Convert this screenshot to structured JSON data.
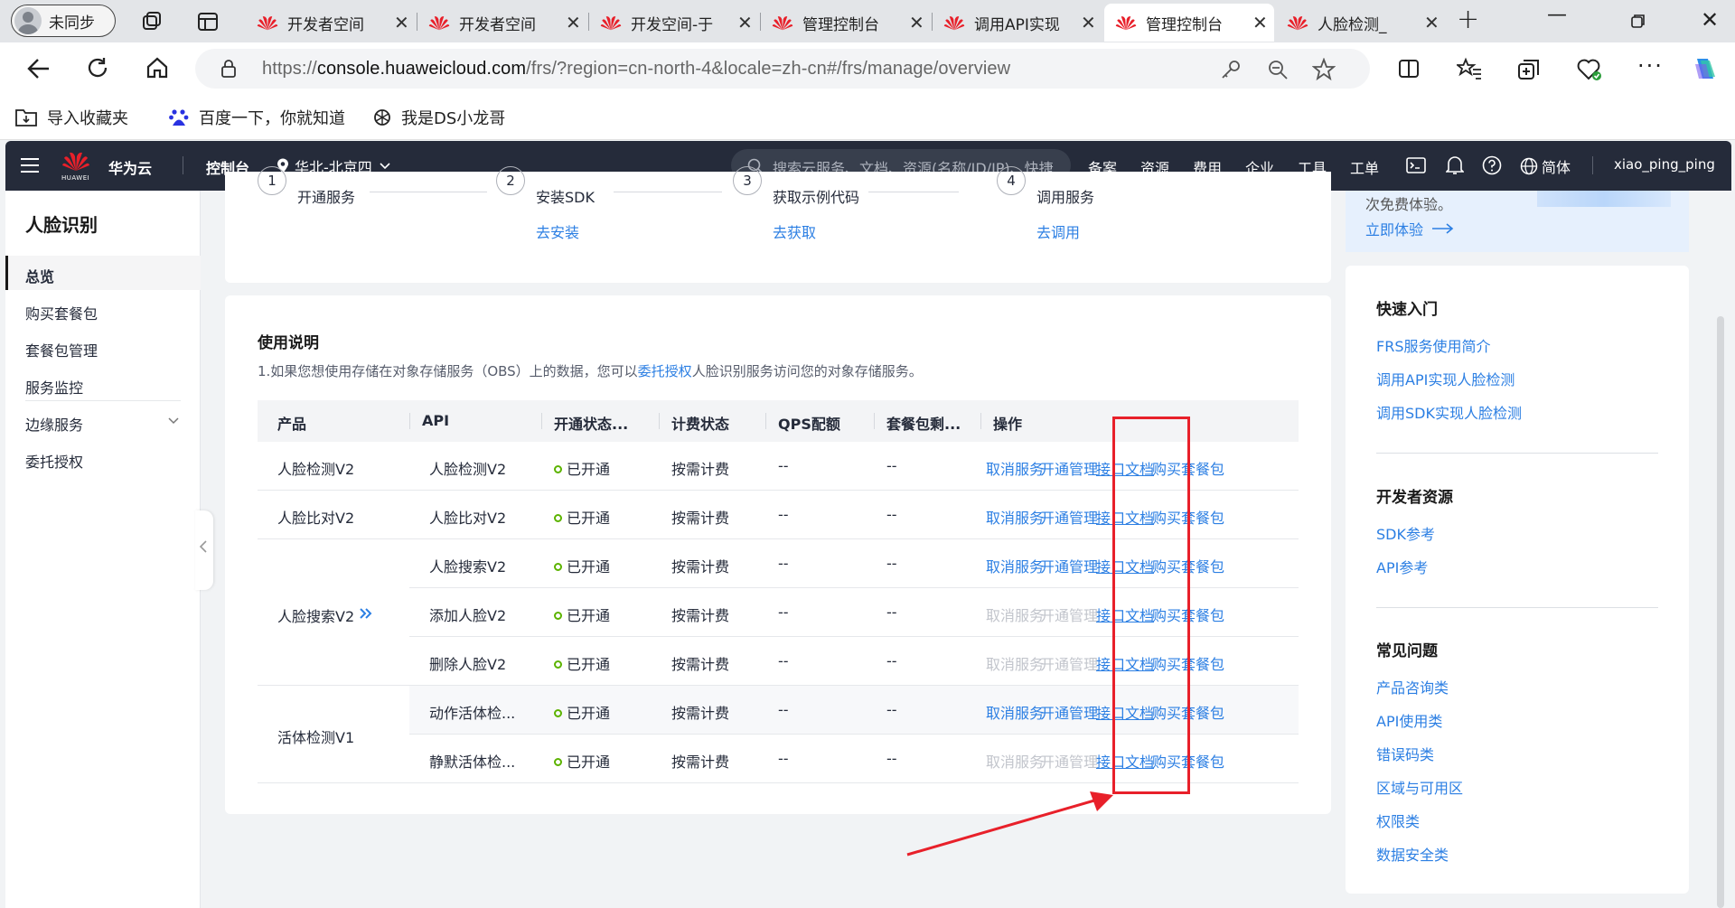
{
  "browser": {
    "profile_label": "未同步",
    "tabs": [
      {
        "title": "开发者空间",
        "active": false
      },
      {
        "title": "开发者空间",
        "active": false
      },
      {
        "title": "开发空间-于",
        "active": false
      },
      {
        "title": "管理控制台",
        "active": false
      },
      {
        "title": "调用API实现",
        "active": false
      },
      {
        "title": "管理控制台",
        "active": true
      },
      {
        "title": "人脸检测_",
        "active": false
      }
    ],
    "url_prefix": "https://",
    "url_host": "console.huaweicloud.com",
    "url_path": "/frs/?region=cn-north-4&locale=zh-cn#/frs/manage/overview",
    "bookmarks": [
      "导入收藏夹",
      "百度一下，你就知道",
      "我是DS小龙哥"
    ]
  },
  "console_header": {
    "brand": "华为云",
    "brand_sub": "HUAWEI",
    "console_label": "控制台",
    "region": "华北-北京四",
    "search_placeholder": "搜索云服务、文档、资源(名称/ID/IP)、快捷...",
    "nav": [
      "备案",
      "资源",
      "费用",
      "企业",
      "工具",
      "工单"
    ],
    "lang": "简体",
    "username": "xiao_ping_ping"
  },
  "sidebar": {
    "title": "人脸识别",
    "items": [
      {
        "label": "总览",
        "active": true
      },
      {
        "label": "购买套餐包",
        "active": false
      },
      {
        "label": "套餐包管理",
        "active": false
      },
      {
        "label": "服务监控",
        "active": false
      },
      {
        "label": "边缘服务",
        "active": false,
        "expandable": true
      },
      {
        "label": "委托授权",
        "active": false
      }
    ]
  },
  "steps": [
    {
      "num": "1",
      "label": "开通服务",
      "link": ""
    },
    {
      "num": "2",
      "label": "安装SDK",
      "link": "去安装"
    },
    {
      "num": "3",
      "label": "获取示例代码",
      "link": "去获取"
    },
    {
      "num": "4",
      "label": "调用服务",
      "link": "去调用"
    }
  ],
  "promo": {
    "text": "次免费体验。",
    "link": "立即体验"
  },
  "usage": {
    "title": "使用说明",
    "note_before": "1.如果您想使用存储在对象存储服务（OBS）上的数据，您可以",
    "note_link": "委托授权",
    "note_after": "人脸识别服务访问您的对象存储服务。"
  },
  "table": {
    "headers": [
      "产品",
      "API",
      "开通状态...",
      "计费状态",
      "QPS配额",
      "套餐包剩...",
      "操作"
    ],
    "groups": [
      {
        "product": "人脸检测V2",
        "has_arrow": false
      },
      {
        "product": "人脸比对V2",
        "has_arrow": false
      },
      {
        "product": "人脸搜索V2",
        "has_arrow": true
      },
      {
        "product": "活体检测V1",
        "has_arrow": false
      }
    ],
    "rows": [
      {
        "api": "人脸检测V2",
        "status": "已开通",
        "billing": "按需计费",
        "qps": "--",
        "package": "--",
        "actions_enabled": true
      },
      {
        "api": "人脸比对V2",
        "status": "已开通",
        "billing": "按需计费",
        "qps": "--",
        "package": "--",
        "actions_enabled": true
      },
      {
        "api": "人脸搜索V2",
        "status": "已开通",
        "billing": "按需计费",
        "qps": "--",
        "package": "--",
        "actions_enabled": true
      },
      {
        "api": "添加人脸V2",
        "status": "已开通",
        "billing": "按需计费",
        "qps": "--",
        "package": "--",
        "actions_enabled": false
      },
      {
        "api": "删除人脸V2",
        "status": "已开通",
        "billing": "按需计费",
        "qps": "--",
        "package": "--",
        "actions_enabled": false
      },
      {
        "api": "动作活体检...",
        "status": "已开通",
        "billing": "按需计费",
        "qps": "--",
        "package": "--",
        "actions_enabled": true
      },
      {
        "api": "静默活体检...",
        "status": "已开通",
        "billing": "按需计费",
        "qps": "--",
        "package": "--",
        "actions_enabled": false
      }
    ],
    "actions": {
      "cancel": "取消服务",
      "manage": "开通管理",
      "docs": "接口文档",
      "buy": "购买套餐包"
    }
  },
  "right_panel": {
    "sections": [
      {
        "title": "快速入门",
        "links": [
          "FRS服务使用简介",
          "调用API实现人脸检测",
          "调用SDK实现人脸检测"
        ]
      },
      {
        "title": "开发者资源",
        "links": [
          "SDK参考",
          "API参考"
        ]
      },
      {
        "title": "常见问题",
        "links": [
          "产品咨询类",
          "API使用类",
          "错误码类",
          "区域与可用区",
          "权限类",
          "数据安全类"
        ]
      }
    ]
  },
  "colors": {
    "header_bg": "#252b3a",
    "link": "#2c7fe3",
    "annotation": "#e8202a",
    "status_ok": "#5cb300"
  }
}
